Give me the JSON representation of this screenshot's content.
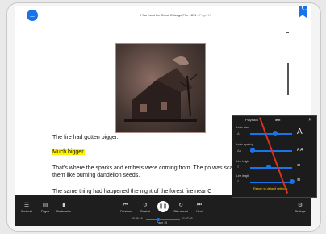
{
  "header": {
    "book_title": "I Survived the Great Chicago Fire 1871",
    "page_indicator": "Page 10"
  },
  "content": {
    "paragraph_1": "The fire had gotten bigger.",
    "paragraph_2": "Much bigger.",
    "paragraph_3": "That's where the sparks and embers were coming from. The po was scattering them like burning dandelion seeds.",
    "paragraph_4": "The same thing had happened the night of the forest fire near C"
  },
  "controls": {
    "left": [
      {
        "label": "Contents",
        "icon": "contents-icon"
      },
      {
        "label": "Pages",
        "icon": "pages-icon"
      },
      {
        "label": "Bookmarks",
        "icon": "bookmarks-icon"
      }
    ],
    "previous_label": "Previous",
    "rewind_label": "Rewind",
    "forward_label": "Skip ahead",
    "next_label": "Next",
    "settings_label": "Settings",
    "time_elapsed": "00:26:16",
    "time_total": "01:47:03",
    "page_label": "Page 10",
    "progress": 0.35
  },
  "settings_panel": {
    "tabs": [
      "Playback",
      "Text"
    ],
    "active_tab": "Text",
    "rows": [
      {
        "label": "Letter size",
        "small": "A",
        "big": "A",
        "level": 0.6
      },
      {
        "label": "Letter spacing",
        "small": "Aa",
        "big": "A A",
        "level": 0.05
      },
      {
        "label": "Line height",
        "small": "≡",
        "big": "≡",
        "level": 0.45
      },
      {
        "label": "Line length",
        "small": "≡",
        "big": "≡",
        "level": 1.0
      }
    ],
    "reset_label": "Return to default settings"
  },
  "colors": {
    "accent": "#1a73e8",
    "highlight": "#fff200",
    "annotation": "#d9301f",
    "controls_bg": "#1e1e1e"
  }
}
